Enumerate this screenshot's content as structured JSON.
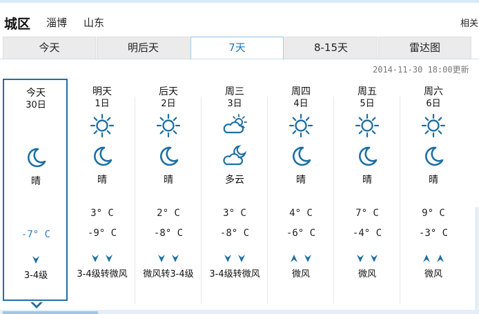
{
  "header": {
    "city": "城区",
    "location_1": "淄博",
    "location_2": "山东",
    "related": "相关"
  },
  "tabs": [
    {
      "label": "今天",
      "active": false
    },
    {
      "label": "明后天",
      "active": false
    },
    {
      "label": "7天",
      "active": true
    },
    {
      "label": "8-15天",
      "active": false
    },
    {
      "label": "雷达图",
      "active": false
    }
  ],
  "updated": "2014-11-30 18:00更新",
  "days": [
    {
      "name": "今天",
      "date": "30日",
      "day_icon": "sun-icon",
      "night_icon": "moon-icon",
      "condition": "晴",
      "high": "",
      "low": "-7° C",
      "wind_icons": [
        "down"
      ],
      "wind": "3-4级"
    },
    {
      "name": "明天",
      "date": "1日",
      "day_icon": "sun-icon",
      "night_icon": "moon-icon",
      "condition": "晴",
      "high": "3° C",
      "low": "-9° C",
      "wind_icons": [
        "down",
        "down"
      ],
      "wind": "3-4级转微风"
    },
    {
      "name": "后天",
      "date": "2日",
      "day_icon": "sun-icon",
      "night_icon": "moon-icon",
      "condition": "晴",
      "high": "2° C",
      "low": "-8° C",
      "wind_icons": [
        "down",
        "down"
      ],
      "wind": "微风转3-4级"
    },
    {
      "name": "周三",
      "date": "3日",
      "day_icon": "partly-cloudy-day-icon",
      "night_icon": "partly-cloudy-night-icon",
      "condition": "多云",
      "high": "3° C",
      "low": "-8° C",
      "wind_icons": [
        "down",
        "down"
      ],
      "wind": "3-4级转微风"
    },
    {
      "name": "周四",
      "date": "4日",
      "day_icon": "sun-icon",
      "night_icon": "moon-icon",
      "condition": "晴",
      "high": "4° C",
      "low": "-6° C",
      "wind_icons": [
        "up",
        "down"
      ],
      "wind": "微风"
    },
    {
      "name": "周五",
      "date": "5日",
      "day_icon": "sun-icon",
      "night_icon": "moon-icon",
      "condition": "晴",
      "high": "7° C",
      "low": "-4° C",
      "wind_icons": [
        "down",
        "down"
      ],
      "wind": "微风"
    },
    {
      "name": "周六",
      "date": "6日",
      "day_icon": "sun-icon",
      "night_icon": "moon-icon",
      "condition": "晴",
      "high": "9° C",
      "low": "-3° C",
      "wind_icons": [
        "up",
        "up"
      ],
      "wind": "微风"
    }
  ],
  "colors": {
    "accent": "#1e6fa0",
    "icon": "#1d6fa3",
    "today_low": "#2b7cc0",
    "tab_bg": "#ebebeb"
  }
}
